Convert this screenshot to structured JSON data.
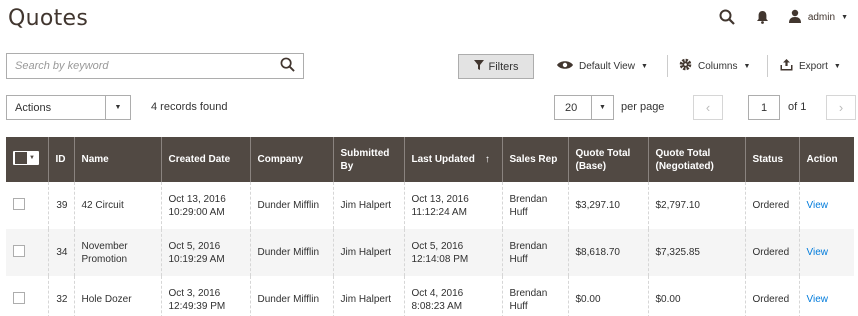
{
  "header": {
    "title": "Quotes",
    "user": "admin"
  },
  "toolbar": {
    "search_placeholder": "Search by keyword",
    "filters_label": "Filters",
    "view_label": "Default View",
    "columns_label": "Columns",
    "export_label": "Export"
  },
  "massactions": {
    "actions_label": "Actions",
    "records_found": "4 records found"
  },
  "pager": {
    "per_page_value": "20",
    "per_page_label": "per page",
    "current_page": "1",
    "of_label": "of 1"
  },
  "grid": {
    "columns": [
      "ID",
      "Name",
      "Created Date",
      "Company",
      "Submitted By",
      "Last Updated",
      "Sales Rep",
      "Quote Total (Base)",
      "Quote Total (Negotiated)",
      "Status",
      "Action"
    ],
    "sort_indicator": "↑",
    "rows": [
      {
        "id": "39",
        "name": "42 Circuit",
        "created": "Oct 13, 2016 10:29:00 AM",
        "company": "Dunder Mifflin",
        "submitted_by": "Jim Halpert",
        "updated": "Oct 13, 2016 11:12:24 AM",
        "sales_rep": "Brendan Huff",
        "total_base": "$3,297.10",
        "total_negotiated": "$2,797.10",
        "status": "Ordered",
        "action": "View"
      },
      {
        "id": "34",
        "name": "November Promotion",
        "created": "Oct 5, 2016 10:19:29 AM",
        "company": "Dunder Mifflin",
        "submitted_by": "Jim Halpert",
        "updated": "Oct 5, 2016 12:14:08 PM",
        "sales_rep": "Brendan Huff",
        "total_base": "$8,618.70",
        "total_negotiated": "$7,325.85",
        "status": "Ordered",
        "action": "View"
      },
      {
        "id": "32",
        "name": "Hole Dozer",
        "created": "Oct 3, 2016 12:49:39 PM",
        "company": "Dunder Mifflin",
        "submitted_by": "Jim Halpert",
        "updated": "Oct 4, 2016 8:08:23 AM",
        "sales_rep": "Brendan Huff",
        "total_base": "$0.00",
        "total_negotiated": "$0.00",
        "status": "Ordered",
        "action": "View"
      }
    ]
  },
  "colors": {
    "header_bg": "#514943",
    "link": "#007bdb",
    "title": "#41362f"
  },
  "icons": {
    "search": "search-icon",
    "bell": "bell-icon",
    "user": "user-icon",
    "filter": "filter-icon",
    "eye": "eye-icon",
    "gear": "gear-icon",
    "export": "export-icon"
  }
}
